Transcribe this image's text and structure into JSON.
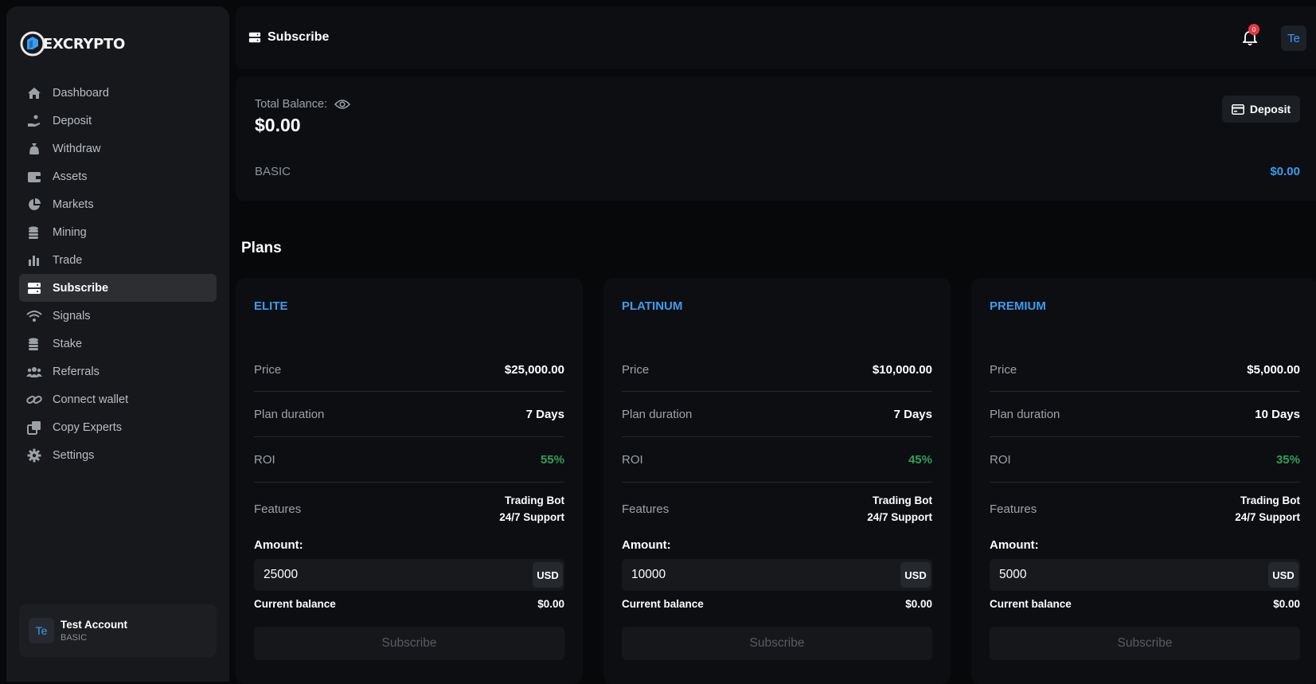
{
  "brand": {
    "name": "EXCRYPTO"
  },
  "sidebar": {
    "items": [
      {
        "label": "Dashboard",
        "icon": "home-icon"
      },
      {
        "label": "Deposit",
        "icon": "hand-coin-icon"
      },
      {
        "label": "Withdraw",
        "icon": "money-bag-icon"
      },
      {
        "label": "Assets",
        "icon": "wallet-icon"
      },
      {
        "label": "Markets",
        "icon": "pie-chart-icon"
      },
      {
        "label": "Mining",
        "icon": "coin-stack-icon"
      },
      {
        "label": "Trade",
        "icon": "bar-chart-icon"
      },
      {
        "label": "Subscribe",
        "icon": "server-icon",
        "active": true
      },
      {
        "label": "Signals",
        "icon": "wifi-icon"
      },
      {
        "label": "Stake",
        "icon": "coin-stack-icon"
      },
      {
        "label": "Referrals",
        "icon": "users-icon"
      },
      {
        "label": "Connect wallet",
        "icon": "link-icon"
      },
      {
        "label": "Copy Experts",
        "icon": "copy-icon"
      },
      {
        "label": "Settings",
        "icon": "gear-icon"
      }
    ],
    "account": {
      "initials": "Te",
      "name": "Test Account",
      "plan": "BASIC"
    }
  },
  "header": {
    "title": "Subscribe",
    "notification_count": "0",
    "avatar_initials": "Te"
  },
  "balance": {
    "label": "Total Balance:",
    "value": "$0.00",
    "deposit_label": "Deposit",
    "plan_name": "BASIC",
    "plan_value": "$0.00"
  },
  "plans_heading": "Plans",
  "plans": [
    {
      "name": "ELITE",
      "price_label": "Price",
      "price": "$25,000.00",
      "duration_label": "Plan duration",
      "duration": "7 Days",
      "roi_label": "ROI",
      "roi": "55%",
      "features_label": "Features",
      "features": [
        "Trading Bot",
        "24/7 Support"
      ],
      "amount_label": "Amount:",
      "amount": "25000",
      "currency": "USD",
      "current_balance_label": "Current balance",
      "current_balance": "$0.00",
      "button": "Subscribe"
    },
    {
      "name": "PLATINUM",
      "price_label": "Price",
      "price": "$10,000.00",
      "duration_label": "Plan duration",
      "duration": "7 Days",
      "roi_label": "ROI",
      "roi": "45%",
      "features_label": "Features",
      "features": [
        "Trading Bot",
        "24/7 Support"
      ],
      "amount_label": "Amount:",
      "amount": "10000",
      "currency": "USD",
      "current_balance_label": "Current balance",
      "current_balance": "$0.00",
      "button": "Subscribe"
    },
    {
      "name": "PREMIUM",
      "price_label": "Price",
      "price": "$5,000.00",
      "duration_label": "Plan duration",
      "duration": "10 Days",
      "roi_label": "ROI",
      "roi": "35%",
      "features_label": "Features",
      "features": [
        "Trading Bot",
        "24/7 Support"
      ],
      "amount_label": "Amount:",
      "amount": "5000",
      "currency": "USD",
      "current_balance_label": "Current balance",
      "current_balance": "$0.00",
      "button": "Subscribe"
    }
  ],
  "colors": {
    "accent": "#3b9cf0",
    "positive": "#2fa15a",
    "badge": "#e53945",
    "background": "#06080a",
    "panel": "#0c0e11",
    "sidebar": "#16181b"
  }
}
